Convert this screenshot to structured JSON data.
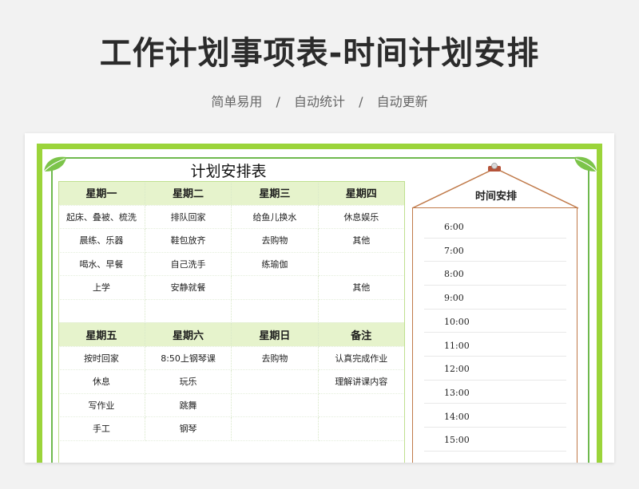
{
  "header": {
    "title": "工作计划事项表-时间计划安排",
    "tags": [
      "简单易用",
      "自动统计",
      "自动更新"
    ],
    "separator": "/"
  },
  "sheet": {
    "title": "计划安排表",
    "week1": {
      "headers": [
        "星期一",
        "星期二",
        "星期三",
        "星期四"
      ],
      "rows": [
        [
          "起床、叠被、梳洗",
          "排队回家",
          "给鱼儿换水",
          "休息娱乐"
        ],
        [
          "晨练、乐器",
          "鞋包放齐",
          "去购物",
          "其他"
        ],
        [
          "喝水、早餐",
          "自己洗手",
          "练瑜伽",
          ""
        ],
        [
          "上学",
          "安静就餐",
          "",
          "其他"
        ],
        [
          "",
          "",
          "",
          ""
        ]
      ]
    },
    "week2": {
      "headers": [
        "星期五",
        "星期六",
        "星期日",
        "备注"
      ],
      "rows": [
        [
          "按时回家",
          "8:50上钢琴课",
          "去购物",
          "认真完成作业"
        ],
        [
          "休息",
          "玩乐",
          "",
          "理解讲课内容"
        ],
        [
          "写作业",
          "跳舞",
          "",
          ""
        ],
        [
          "手工",
          "钢琴",
          "",
          ""
        ]
      ]
    }
  },
  "schedule": {
    "title": "时间安排",
    "times": [
      "6:00",
      "7:00",
      "8:00",
      "9:00",
      "10:00",
      "11:00",
      "12:00",
      "13:00",
      "14:00",
      "15:00"
    ]
  },
  "colors": {
    "frame": "#9bd43a",
    "header_fill": "#e6f3cc",
    "panel_border": "#c07a4a"
  }
}
